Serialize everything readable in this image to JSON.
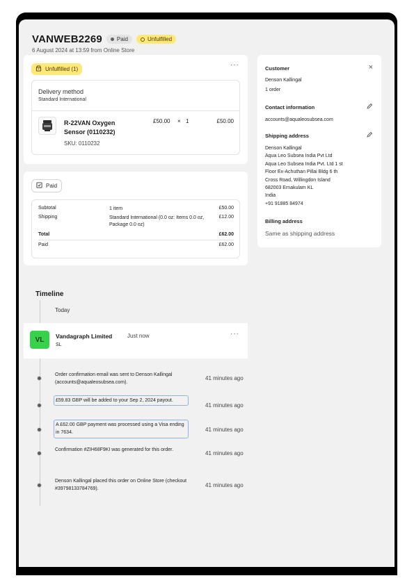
{
  "order": {
    "id": "VANWEB2269",
    "payment_status": "Paid",
    "fulfillment_status": "Unfulfilled",
    "subtitle": "6 August 2024 at 13:59 from Online Store"
  },
  "fulfillment_card": {
    "badge": "Unfulfilled (1)",
    "more": "···",
    "delivery_label": "Delivery method",
    "delivery_value": "Standard International",
    "product": {
      "name": "R-22VAN Oxygen Sensor (0110232)",
      "sku": "SKU: 0110232",
      "unit_price": "£50.00",
      "times": "×",
      "quantity": "1",
      "line_total": "£50.00"
    }
  },
  "payment_card": {
    "badge": "Paid",
    "rows": [
      {
        "label": "Subtotal",
        "detail": "1 item",
        "amount": "£50.00"
      },
      {
        "label": "Shipping",
        "detail": "Standard International (0.0 oz: Items 0.0 oz, Package 0.0 oz)",
        "amount": "£12.00"
      },
      {
        "label": "Total",
        "detail": "",
        "amount": "£62.00"
      },
      {
        "label": "Paid",
        "detail": "",
        "amount": "£62.00"
      }
    ]
  },
  "customer": {
    "heading": "Customer",
    "close": "×",
    "name": "Denson Kallingal",
    "orders": "1 order",
    "contact_heading": "Contact information",
    "email": "accounts@aqualeosubsea.com",
    "shipping_heading": "Shipping address",
    "shipping_lines": [
      "Denson Kallingal",
      "Aqua Leo Subsea India Pvt Ltd",
      "Aqua Leo Subsea India Pvt. Ltd 1 st",
      "Floor Ex-Achuthan Pillai Bldg 6 th",
      "Cross Road, Willingdon Island",
      "682003 Ernakulam KL",
      "India",
      "+91 91885 84974"
    ],
    "billing_heading": "Billing address",
    "billing_value": "Same as shipping address"
  },
  "timeline": {
    "title": "Timeline",
    "today": "Today",
    "comment": {
      "initials": "VL",
      "author": "Vandagraph Limited",
      "time": "Just now",
      "body": "SL",
      "more": "···"
    },
    "events": [
      {
        "text": "Order confirmation email was sent to Denson Kallingal (accounts@aqualeosubsea.com).",
        "time": "41 minutes ago"
      },
      {
        "text": "£59.83 GBP will be added to your Sep 2, 2024 payout.",
        "time": "41 minutes ago"
      },
      {
        "text": "A £62.00 GBP payment was processed using a Visa ending in 7634.",
        "time": "41 minutes ago"
      },
      {
        "text": "Confirmation #ZIH68F9KI was generated for this order.",
        "time": "41 minutes ago"
      },
      {
        "text": "Denson Kallingal placed this order on Online Store (checkout #39798133784769).",
        "time": "41 minutes ago"
      }
    ]
  },
  "colors": {
    "unfulfilled_badge": "#ffe87a",
    "avatar": "#36d24c",
    "background": "#f1f1f1"
  }
}
